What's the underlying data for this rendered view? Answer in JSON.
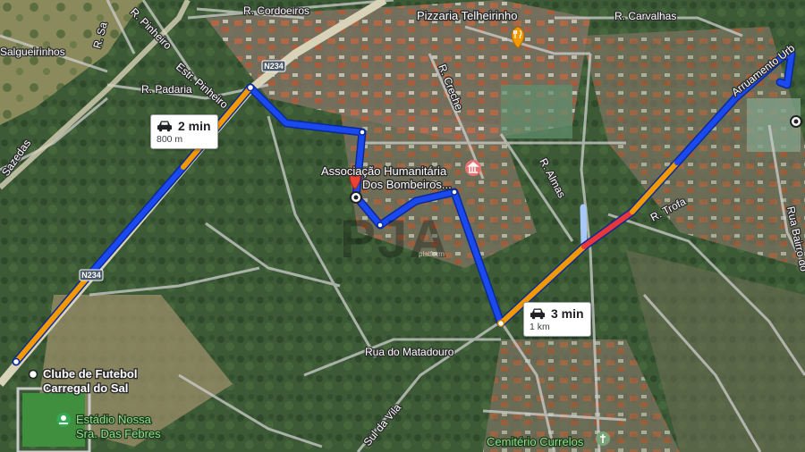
{
  "streets": {
    "cordoeiros": "R. Cordoeiros",
    "carvalhas": "R. Carvalhas",
    "salgueirinhos": "Salgueirinhos",
    "padaria": "R. Padaria",
    "estr_pinheiro": "Estr. Pinheiro",
    "r_pinheiro": "R. Pinheiro",
    "r_sao": "R. Sa",
    "sazedas": "Sazedas",
    "creche": "R. Creche",
    "almas": "R. Almas",
    "trofa": "R. Trofa",
    "arruamento": "Arruamento Urb",
    "bairro": "Rua Bairro do",
    "matadouro": "Rua do Matadouro",
    "vila": "Sul da Vila"
  },
  "road_shields": {
    "top": "N234",
    "left": "N234"
  },
  "pois": {
    "pizzaria": "Pizzaria Telheirinho",
    "associacao_line1": "Associação Humanitária",
    "associacao_line2": "Dos Bombeiros...",
    "clube_line1": "Clube de Futebol",
    "clube_line2": "Carregal do Sal",
    "estadio_line1": "Estádio Nossa",
    "estadio_line2": "Sra. Das Febres",
    "cemiterio": "Cemitério Currelos"
  },
  "route_bubbles": [
    {
      "time": "2 min",
      "distance": "800 m"
    },
    {
      "time": "3 min",
      "distance": "1 km"
    }
  ],
  "watermark": {
    "text": "PJA",
    "sub": "platform"
  },
  "colors": {
    "route_blue": "#1a49f0",
    "traffic_orange": "#f29900",
    "traffic_red": "#e8363a",
    "route_alt": "#a8c7fa",
    "poi_red": "#ea4335",
    "pizza_orange": "#f29900",
    "park_green": "#34a853"
  },
  "icons": {
    "car": "car-icon",
    "pizzeria": "fork-knife-icon",
    "museum": "building-icon",
    "pin": "location-pin-icon",
    "cemetery": "cemetery-icon",
    "stadium": "stadium-icon"
  }
}
